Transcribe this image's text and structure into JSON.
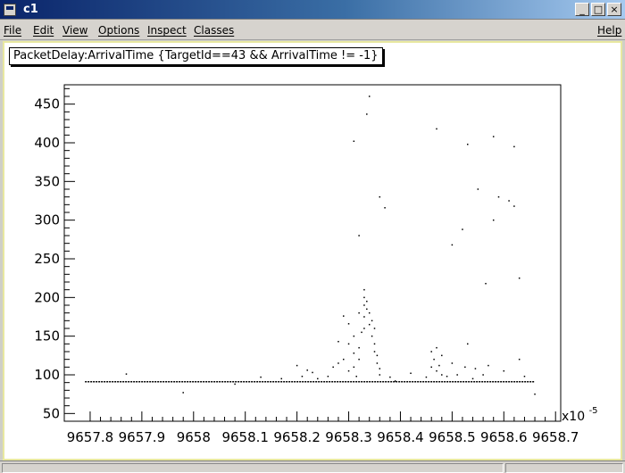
{
  "window": {
    "title": "c1"
  },
  "menu": {
    "items": [
      "File",
      "Edit",
      "View",
      "Options",
      "Inspect",
      "Classes"
    ],
    "help": "Help"
  },
  "colors": {
    "titlebar": "#0a246a",
    "canvas_border": "#e8e8a0",
    "points": "#000000"
  },
  "chart_data": {
    "type": "scatter",
    "title": "PacketDelay:ArrivalTime {TargetId==43 && ArrivalTime != -1}",
    "xlabel": "",
    "ylabel": "",
    "x_exponent_label": "x10",
    "x_exponent_power": "-5",
    "xlim": [
      9657.75,
      9658.71
    ],
    "ylim": [
      40,
      475
    ],
    "x_ticks": [
      9657.8,
      9657.9,
      9658.0,
      9658.1,
      9658.2,
      9658.3,
      9658.4,
      9658.5,
      9658.6,
      9658.7
    ],
    "x_tick_labels": [
      "9657.8",
      "9657.9",
      "9658",
      "9658.1",
      "9658.2",
      "9658.3",
      "9658.4",
      "9658.5",
      "9658.6",
      "9658.7"
    ],
    "y_ticks": [
      50,
      100,
      150,
      200,
      250,
      300,
      350,
      400,
      450
    ],
    "y_tick_labels": [
      "50",
      "100",
      "150",
      "200",
      "250",
      "300",
      "350",
      "400",
      "450"
    ],
    "baseline": {
      "x_start": 9657.79,
      "x_end": 9658.66,
      "y": 91
    },
    "points": [
      [
        9657.87,
        101
      ],
      [
        9657.98,
        77
      ],
      [
        9658.08,
        88
      ],
      [
        9658.13,
        97
      ],
      [
        9658.17,
        95
      ],
      [
        9658.2,
        112
      ],
      [
        9658.21,
        98
      ],
      [
        9658.22,
        106
      ],
      [
        9658.23,
        103
      ],
      [
        9658.24,
        95
      ],
      [
        9658.26,
        98
      ],
      [
        9658.27,
        110
      ],
      [
        9658.28,
        115
      ],
      [
        9658.28,
        143
      ],
      [
        9658.29,
        120
      ],
      [
        9658.29,
        176
      ],
      [
        9658.3,
        105
      ],
      [
        9658.3,
        140
      ],
      [
        9658.3,
        166
      ],
      [
        9658.31,
        110
      ],
      [
        9658.31,
        128
      ],
      [
        9658.31,
        150
      ],
      [
        9658.31,
        402
      ],
      [
        9658.315,
        98
      ],
      [
        9658.32,
        120
      ],
      [
        9658.32,
        135
      ],
      [
        9658.32,
        180
      ],
      [
        9658.32,
        280
      ],
      [
        9658.325,
        155
      ],
      [
        9658.33,
        160
      ],
      [
        9658.33,
        175
      ],
      [
        9658.33,
        190
      ],
      [
        9658.33,
        200
      ],
      [
        9658.33,
        210
      ],
      [
        9658.335,
        185
      ],
      [
        9658.335,
        195
      ],
      [
        9658.335,
        437
      ],
      [
        9658.34,
        165
      ],
      [
        9658.34,
        180
      ],
      [
        9658.34,
        460
      ],
      [
        9658.345,
        150
      ],
      [
        9658.345,
        170
      ],
      [
        9658.35,
        130
      ],
      [
        9658.35,
        160
      ],
      [
        9658.35,
        140
      ],
      [
        9658.355,
        115
      ],
      [
        9658.355,
        125
      ],
      [
        9658.36,
        100
      ],
      [
        9658.36,
        108
      ],
      [
        9658.36,
        330
      ],
      [
        9658.37,
        316
      ],
      [
        9658.38,
        97
      ],
      [
        9658.39,
        92
      ],
      [
        9658.42,
        102
      ],
      [
        9658.45,
        97
      ],
      [
        9658.46,
        110
      ],
      [
        9658.46,
        130
      ],
      [
        9658.465,
        120
      ],
      [
        9658.47,
        105
      ],
      [
        9658.47,
        135
      ],
      [
        9658.47,
        418
      ],
      [
        9658.475,
        112
      ],
      [
        9658.48,
        100
      ],
      [
        9658.48,
        125
      ],
      [
        9658.49,
        98
      ],
      [
        9658.5,
        268
      ],
      [
        9658.5,
        115
      ],
      [
        9658.51,
        100
      ],
      [
        9658.52,
        288
      ],
      [
        9658.525,
        110
      ],
      [
        9658.53,
        140
      ],
      [
        9658.53,
        398
      ],
      [
        9658.54,
        95
      ],
      [
        9658.545,
        108
      ],
      [
        9658.55,
        340
      ],
      [
        9658.56,
        100
      ],
      [
        9658.565,
        218
      ],
      [
        9658.57,
        112
      ],
      [
        9658.58,
        408
      ],
      [
        9658.58,
        300
      ],
      [
        9658.59,
        330
      ],
      [
        9658.6,
        105
      ],
      [
        9658.61,
        325
      ],
      [
        9658.62,
        318
      ],
      [
        9658.62,
        395
      ],
      [
        9658.63,
        225
      ],
      [
        9658.63,
        120
      ],
      [
        9658.64,
        98
      ],
      [
        9658.66,
        75
      ]
    ]
  }
}
